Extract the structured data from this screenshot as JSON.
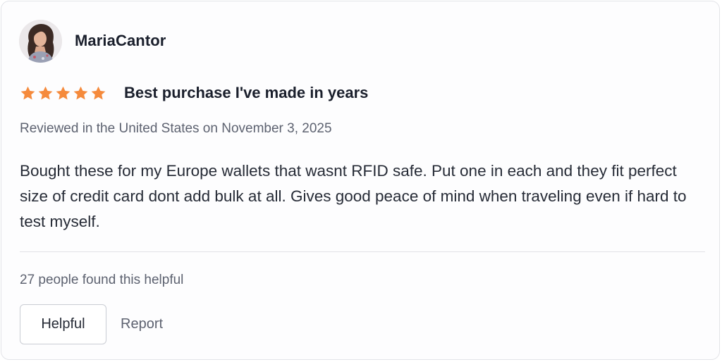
{
  "reviewer": {
    "name": "MariaCantor",
    "avatar_icon": "user-avatar-photo"
  },
  "rating": {
    "stars": 5,
    "max": 5,
    "star_color": "#f58a3c",
    "star_icon": "star-icon"
  },
  "review": {
    "title": "Best purchase I've made in years",
    "meta": "Reviewed in the United States on November 3, 2025",
    "body": "Bought these for my Europe wallets that wasnt RFID safe. Put one in each and they fit perfect size of credit card dont add bulk at all. Gives good peace of mind when traveling even if hard to test myself."
  },
  "footer": {
    "helpful_count": "27 people found this helpful",
    "helpful_button": "Helpful",
    "report_link": "Report"
  }
}
